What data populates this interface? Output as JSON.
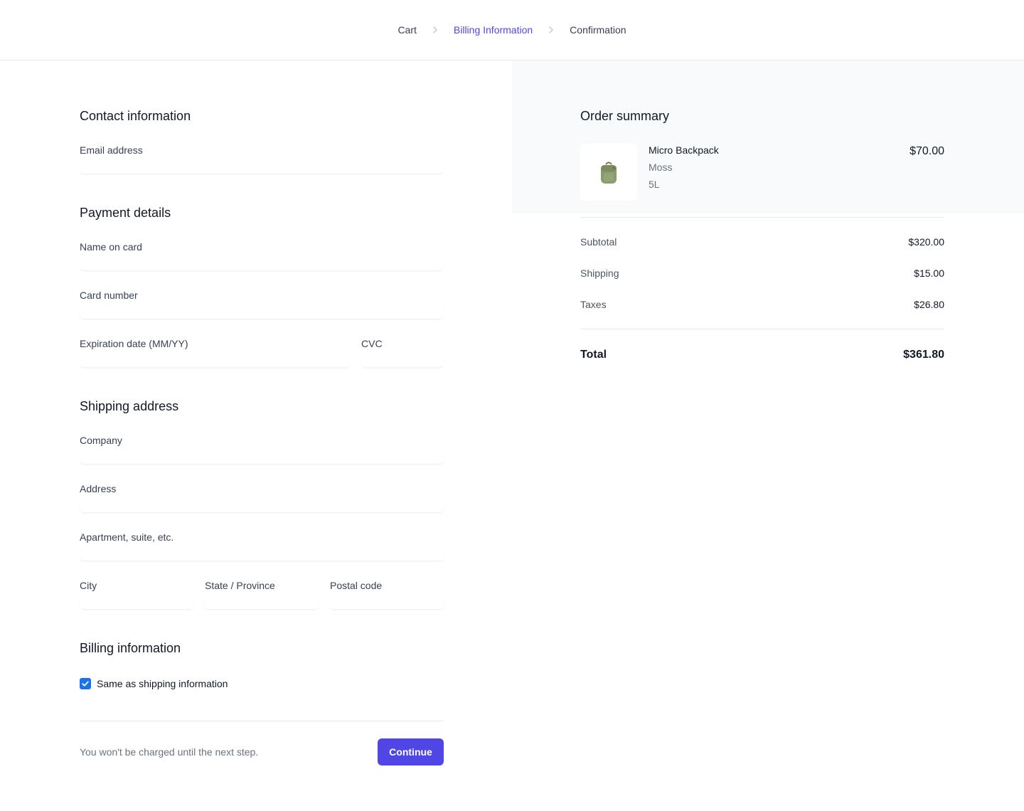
{
  "breadcrumb": {
    "steps": [
      "Cart",
      "Billing Information",
      "Confirmation"
    ],
    "current_index": 1,
    "separator_icon": "chevron-right-icon"
  },
  "form": {
    "contact": {
      "title": "Contact information",
      "email_label": "Email address",
      "email_value": ""
    },
    "payment": {
      "title": "Payment details",
      "name_label": "Name on card",
      "name_value": "",
      "card_label": "Card number",
      "card_value": "",
      "exp_label": "Expiration date (MM/YY)",
      "exp_value": "",
      "cvc_label": "CVC",
      "cvc_value": ""
    },
    "shipping": {
      "title": "Shipping address",
      "company_label": "Company",
      "company_value": "",
      "address_label": "Address",
      "address_value": "",
      "apartment_label": "Apartment, suite, etc.",
      "apartment_value": "",
      "city_label": "City",
      "city_value": "",
      "state_label": "State / Province",
      "state_value": "",
      "postal_label": "Postal code",
      "postal_value": ""
    },
    "billing": {
      "title": "Billing information",
      "same_as_shipping_label": "Same as shipping information",
      "same_as_shipping_checked": true
    },
    "footer": {
      "note": "You won't be charged until the next step.",
      "continue_label": "Continue"
    }
  },
  "summary": {
    "title": "Order summary",
    "item": {
      "name": "Micro Backpack",
      "color": "Moss",
      "size": "5L",
      "price": "$70.00",
      "image_icon": "backpack-icon"
    },
    "subtotal_label": "Subtotal",
    "subtotal_value": "$320.00",
    "shipping_label": "Shipping",
    "shipping_value": "$15.00",
    "taxes_label": "Taxes",
    "taxes_value": "$26.80",
    "total_label": "Total",
    "total_value": "$361.80"
  },
  "colors": {
    "accent": "#4f46e5",
    "checkbox": "#1a73e8",
    "summary_bg": "#f9fafb",
    "muted_text": "#6b7280"
  }
}
